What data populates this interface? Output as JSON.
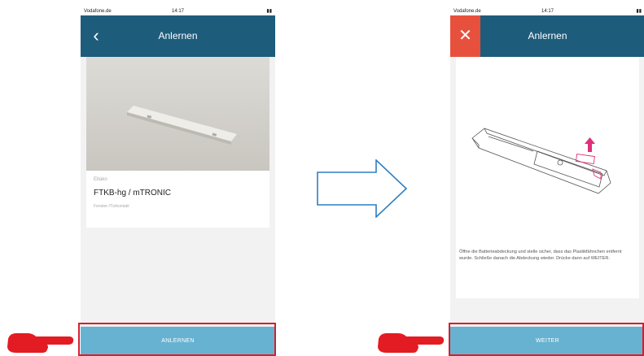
{
  "left_screen": {
    "status": {
      "carrier": "Vodafone.de",
      "time": "14:17",
      "battery": ""
    },
    "nav_title": "Anlernen",
    "card": {
      "brand": "Eltako",
      "model": "FTKB-hg / mTRONIC",
      "subtitle": "Fenster-/Türkontakt"
    },
    "button_label": "ANLERNEN"
  },
  "right_screen": {
    "status": {
      "carrier": "Vodafone.de",
      "time": "14:17",
      "battery": ""
    },
    "nav_title": "Anlernen",
    "instruction": "Öffne die Batterieabdeckung und stelle sicher, dass das Plastikfähnchen entfernt wurde. Schließe danach die Abdeckung wieder. Drücke dann auf WEITER.",
    "button_label": "WEITER"
  },
  "colors": {
    "navbar": "#1e5c7c",
    "button": "#67b2d1",
    "close": "#e8503e",
    "highlight": "#d81e2c",
    "arrow": "#2e7fc0",
    "pink": "#e0307a"
  }
}
